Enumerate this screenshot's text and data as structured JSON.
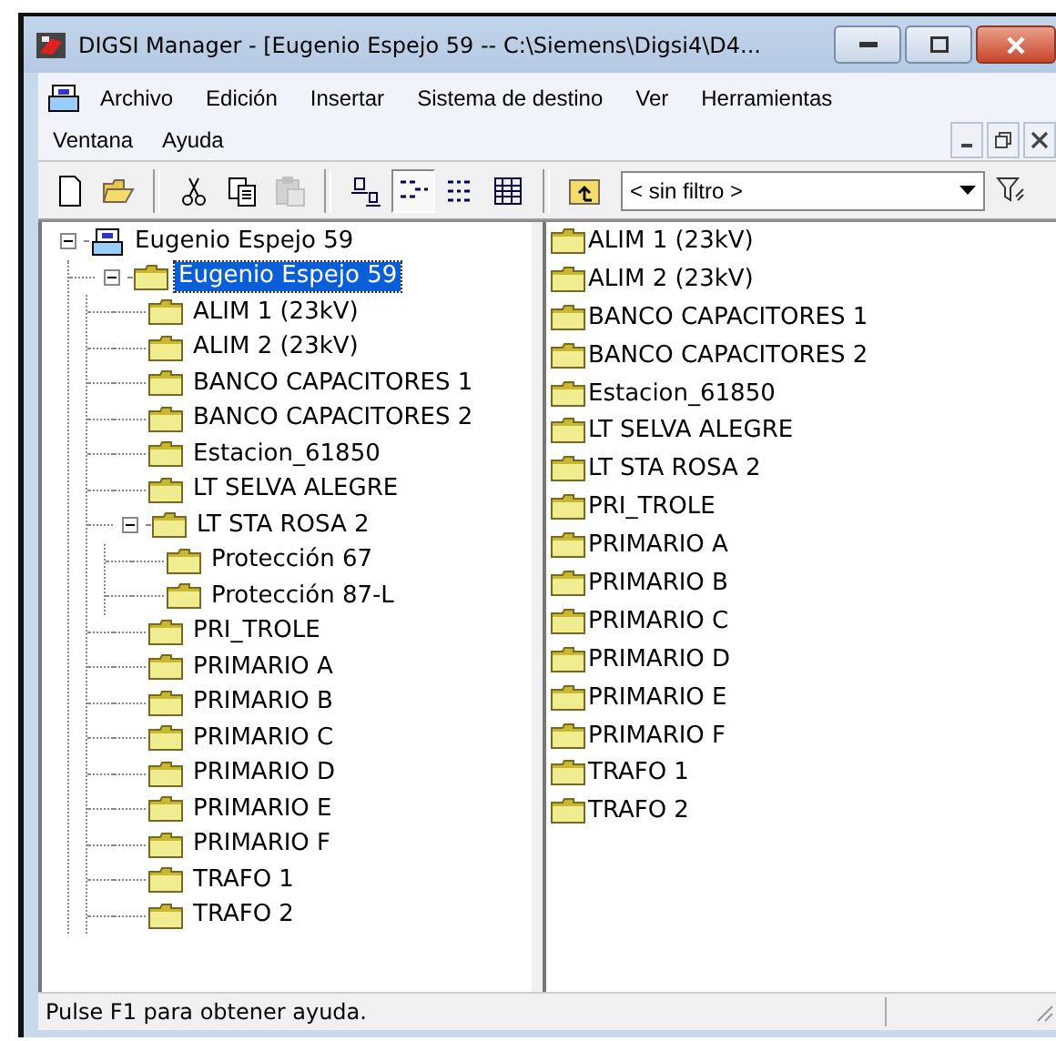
{
  "window": {
    "title": "DIGSI Manager - [Eugenio Espejo 59 -- C:\\Siemens\\Digsi4\\D4..."
  },
  "menu_bar": {
    "rows": [
      [
        "Archivo",
        "Edición",
        "Insertar",
        "Sistema de destino",
        "Ver",
        "Herramientas"
      ],
      [
        "Ventana",
        "Ayuda"
      ]
    ]
  },
  "toolbar": {
    "buttons": [
      {
        "kind": "new",
        "disabled": false,
        "pressed": false
      },
      {
        "kind": "open",
        "disabled": false,
        "pressed": false
      },
      {
        "kind": "separator"
      },
      {
        "kind": "cut",
        "disabled": false,
        "pressed": false
      },
      {
        "kind": "copy",
        "disabled": false,
        "pressed": false
      },
      {
        "kind": "paste",
        "disabled": true,
        "pressed": false
      },
      {
        "kind": "separator"
      },
      {
        "kind": "large-icons",
        "disabled": false,
        "pressed": false
      },
      {
        "kind": "small-icons",
        "disabled": false,
        "pressed": true
      },
      {
        "kind": "list",
        "disabled": false,
        "pressed": false
      },
      {
        "kind": "details",
        "disabled": false,
        "pressed": false
      },
      {
        "kind": "separator"
      },
      {
        "kind": "up-folder",
        "disabled": false,
        "pressed": false
      }
    ],
    "filter": {
      "value": "< sin filtro >"
    }
  },
  "tree": [
    {
      "label": "Eugenio Espejo 59",
      "kind": "project",
      "expanded": true,
      "selected": false,
      "children": [
        {
          "label": "Eugenio Espejo 59",
          "kind": "folder",
          "expanded": true,
          "selected": true,
          "children": [
            {
              "label": "ALIM 1 (23kV)",
              "kind": "folder",
              "selected": false
            },
            {
              "label": "ALIM 2 (23kV)",
              "kind": "folder",
              "selected": false
            },
            {
              "label": "BANCO CAPACITORES 1",
              "kind": "folder",
              "selected": false
            },
            {
              "label": "BANCO CAPACITORES 2",
              "kind": "folder",
              "selected": false
            },
            {
              "label": "Estacion_61850",
              "kind": "folder",
              "selected": false
            },
            {
              "label": "LT SELVA ALEGRE",
              "kind": "folder",
              "selected": false
            },
            {
              "label": "LT STA ROSA 2",
              "kind": "folder",
              "expanded": true,
              "selected": false,
              "children": [
                {
                  "label": "Protección 67",
                  "kind": "folder",
                  "selected": false
                },
                {
                  "label": "Protección 87-L",
                  "kind": "folder",
                  "selected": false
                }
              ]
            },
            {
              "label": "PRI_TROLE",
              "kind": "folder",
              "selected": false
            },
            {
              "label": "PRIMARIO A",
              "kind": "folder",
              "selected": false
            },
            {
              "label": "PRIMARIO B",
              "kind": "folder",
              "selected": false
            },
            {
              "label": "PRIMARIO C",
              "kind": "folder",
              "selected": false
            },
            {
              "label": "PRIMARIO D",
              "kind": "folder",
              "selected": false
            },
            {
              "label": "PRIMARIO E",
              "kind": "folder",
              "selected": false
            },
            {
              "label": "PRIMARIO F",
              "kind": "folder",
              "selected": false
            },
            {
              "label": "TRAFO 1",
              "kind": "folder",
              "selected": false
            },
            {
              "label": "TRAFO 2",
              "kind": "folder",
              "selected": false
            }
          ]
        }
      ]
    }
  ],
  "contents": {
    "items": [
      "ALIM 1 (23kV)",
      "ALIM 2 (23kV)",
      "BANCO CAPACITORES 1",
      "BANCO CAPACITORES 2",
      "Estacion_61850",
      "LT SELVA ALEGRE",
      "LT STA ROSA 2",
      "PRI_TROLE",
      "PRIMARIO A",
      "PRIMARIO B",
      "PRIMARIO C",
      "PRIMARIO D",
      "PRIMARIO E",
      "PRIMARIO F",
      "TRAFO 1",
      "TRAFO 2"
    ]
  },
  "status_bar": {
    "text": "Pulse F1 para obtener ayuda."
  }
}
